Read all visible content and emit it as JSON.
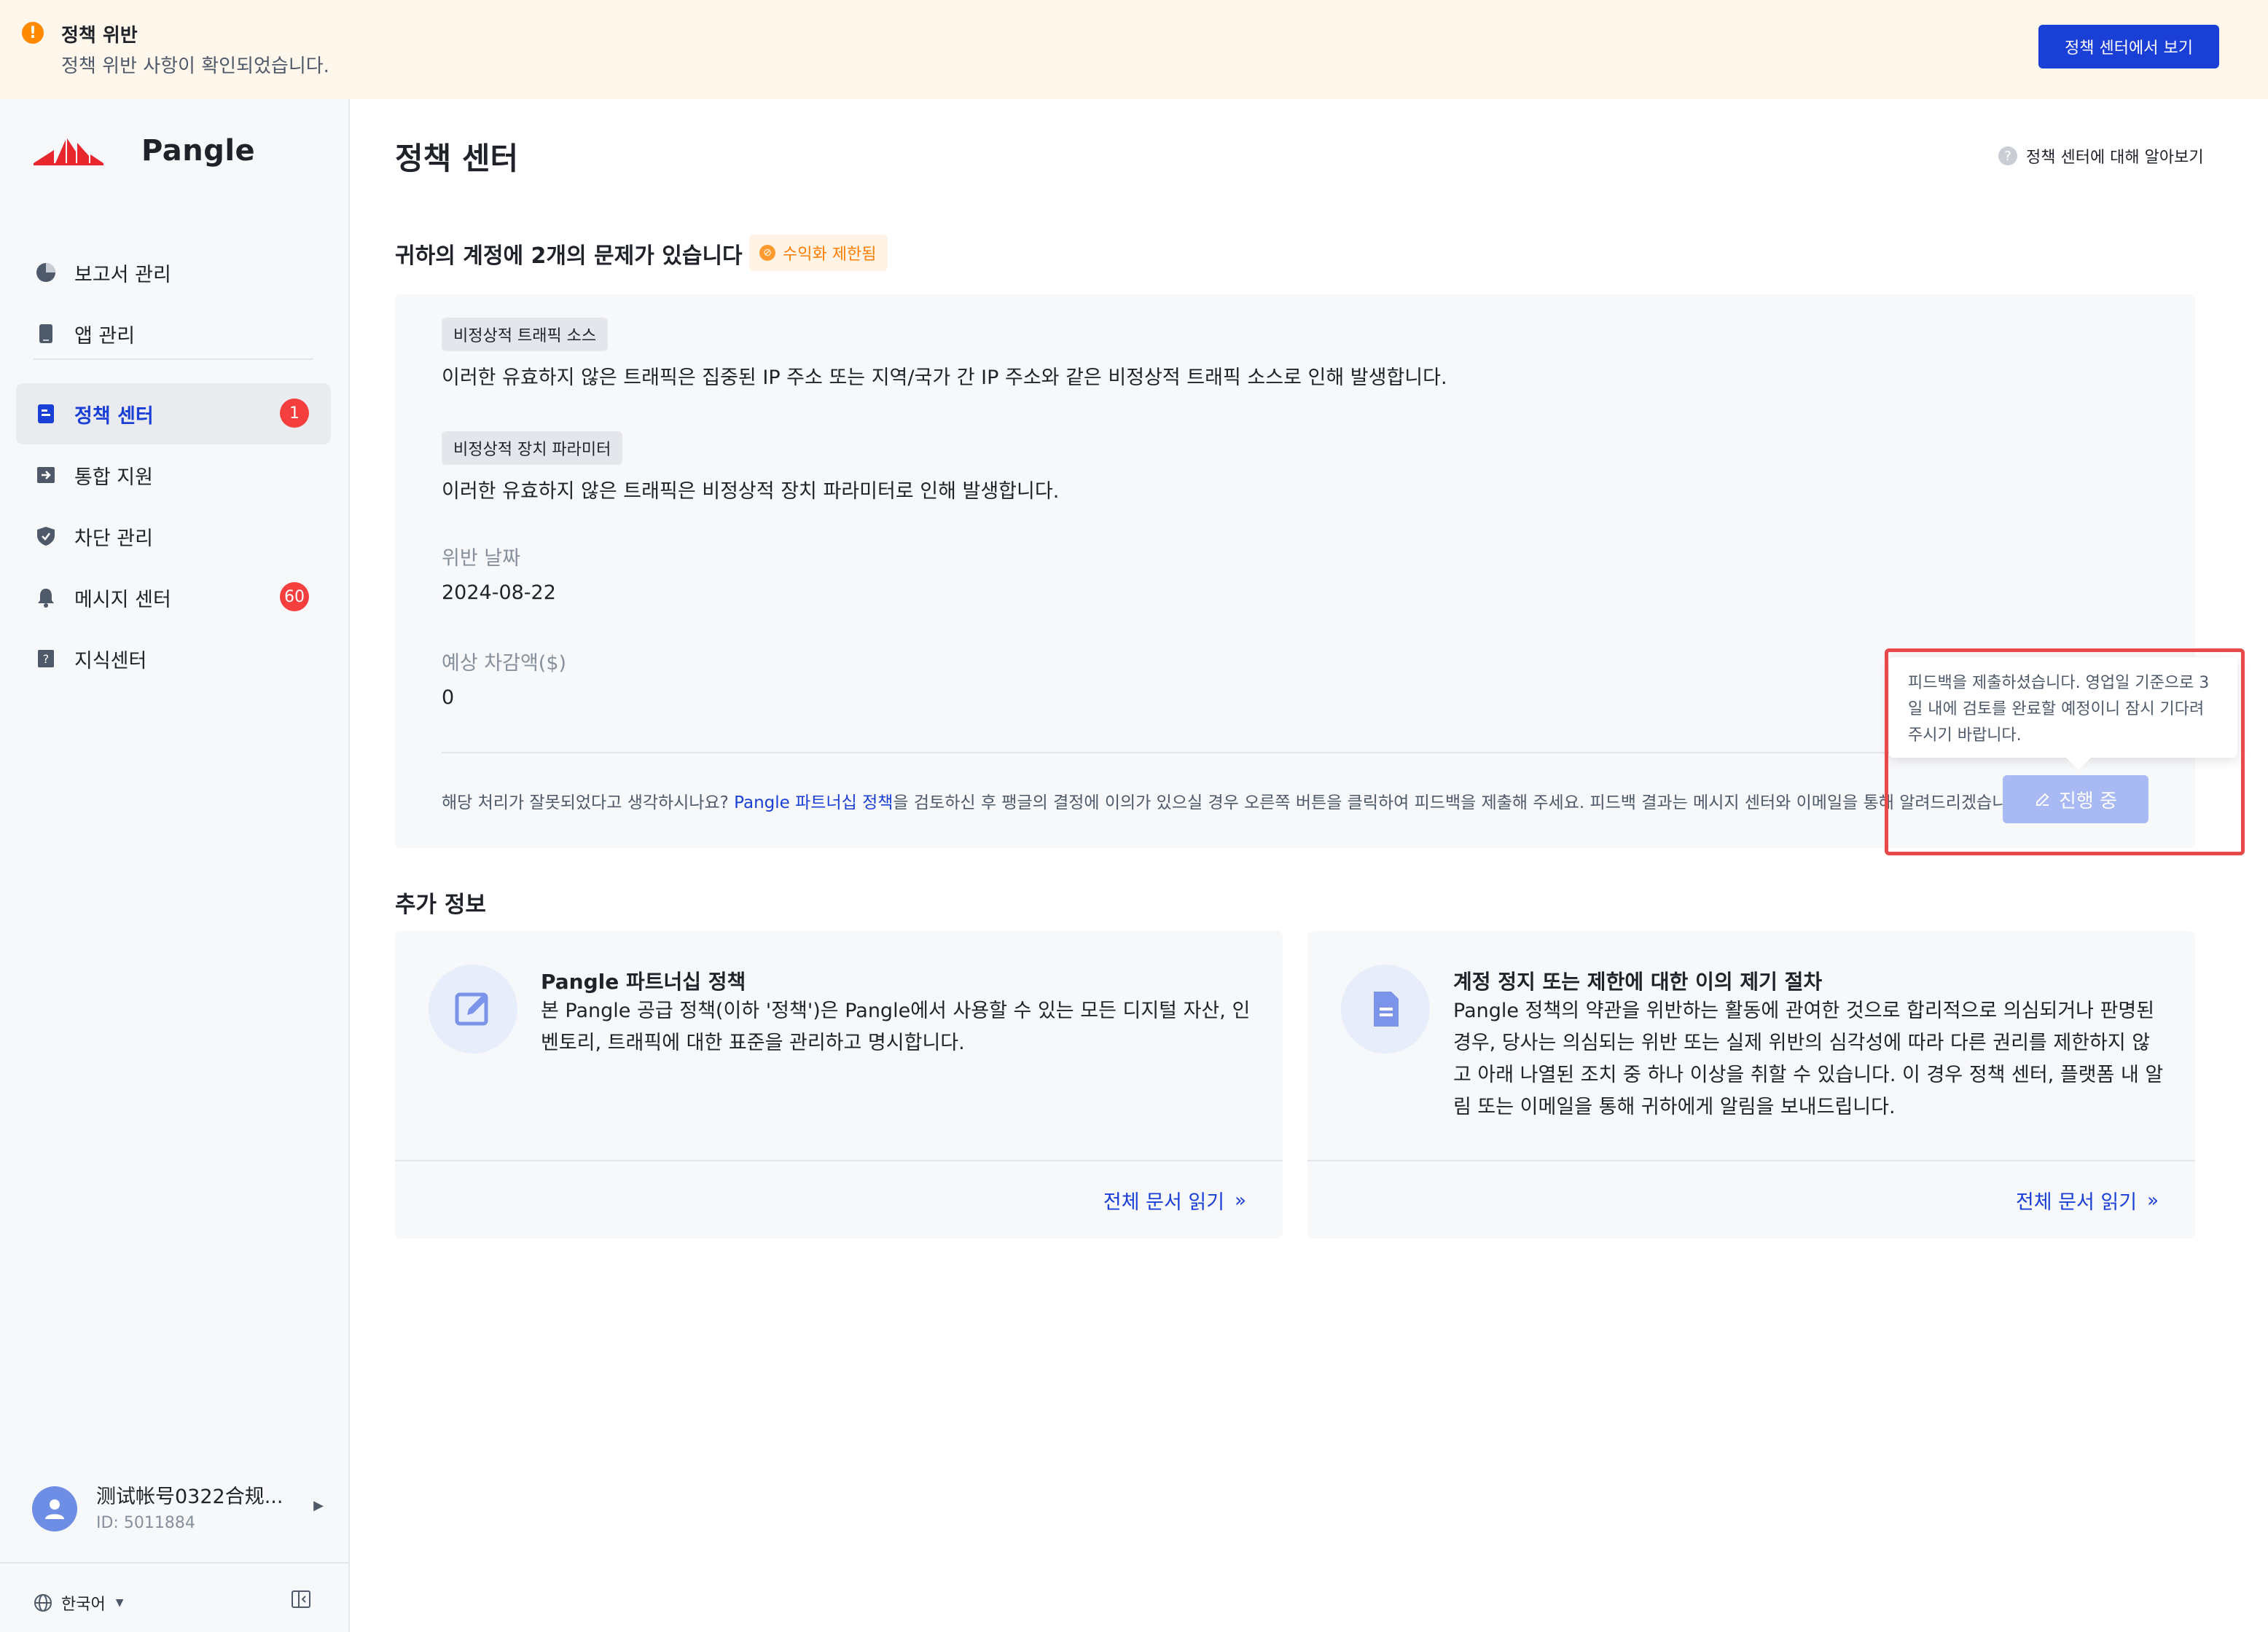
{
  "banner": {
    "title": "정책 위반",
    "description": "정책 위반 사항이 확인되었습니다.",
    "button_label": "정책 센터에서 보기"
  },
  "sidebar": {
    "logo_text": "Pangle",
    "items": [
      {
        "label": "보고서 관리",
        "icon": "pie-chart-icon"
      },
      {
        "label": "앱 관리",
        "icon": "phone-icon"
      },
      {
        "label": "정책 센터",
        "icon": "policy-doc-icon",
        "badge": "1",
        "active": true
      },
      {
        "label": "통합 지원",
        "icon": "integration-icon"
      },
      {
        "label": "차단 관리",
        "icon": "shield-icon"
      },
      {
        "label": "메시지 센터",
        "icon": "bell-icon",
        "badge": "60"
      },
      {
        "label": "지식센터",
        "icon": "knowledge-icon"
      }
    ],
    "user": {
      "name": "测试帐号0322合规...",
      "id": "ID: 5011884"
    },
    "language": "한국어"
  },
  "main": {
    "title": "정책 센터",
    "help_link": "정책 센터에 대해 알아보기",
    "issues_heading": "귀하의 계정에 2개의 문제가 있습니다",
    "status_tag": "수익화 제한됨",
    "issues": [
      {
        "tag": "비정상적 트래픽 소스",
        "description": "이러한 유효하지 않은 트래픽은 집중된 IP 주소 또는 지역/국가 간 IP 주소와 같은 비정상적 트래픽 소스로 인해 발생합니다."
      },
      {
        "tag": "비정상적 장치 파라미터",
        "description": "이러한 유효하지 않은 트래픽은 비정상적 장치 파라미터로 인해 발생합니다."
      }
    ],
    "violation_date_label": "위반 날짜",
    "violation_date": "2024-08-22",
    "deduction_label": "예상 차감액($)",
    "deduction_value": "0",
    "footer_note_before": "해당 처리가 잘못되었다고 생각하시나요? ",
    "footer_note_link": "Pangle 파트너십 정책",
    "footer_note_after": "을 검토하신 후 팽글의 결정에 이의가 있으실 경우 오른쪽 버튼을 클릭하여 피드백을 제출해 주세요. 피드백 결과는 메시지 센터와 이메일을 통해 알려드리겠습니다.",
    "progress_button": "진행 중",
    "tooltip": "피드백을 제출하셨습니다. 영업일 기준으로 3일 내에 검토를 완료할 예정이니 잠시 기다려 주시기 바랍니다."
  },
  "extra": {
    "heading": "추가 정보",
    "cards": [
      {
        "title": "Pangle 파트너십 정책",
        "description": "본 Pangle 공급 정책(이하 '정책')은 Pangle에서 사용할 수 있는 모든 디지털 자산, 인벤토리, 트래픽에 대한 표준을 관리하고 명시합니다.",
        "link": "전체 문서 읽기",
        "icon": "edit-icon"
      },
      {
        "title": "계정 정지 또는 제한에 대한 이의 제기 절차",
        "description": "Pangle 정책의 약관을 위반하는 활동에 관여한 것으로 합리적으로 의심되거나 판명된 경우, 당사는 의심되는 위반 또는 실제 위반의 심각성에 따라 다른 권리를 제한하지 않고 아래 나열된 조치 중 하나 이상을 취할 수 있습니다. 이 경우 정책 센터, 플랫폼 내 알림 또는 이메일을 통해 귀하에게 알림을 보내드립니다.",
        "link": "전체 문서 읽기",
        "icon": "document-icon"
      }
    ]
  },
  "colors": {
    "accent": "#1a3fd6",
    "warning": "#ff8a00",
    "badge": "#f53f3f",
    "highlight": "#e84a4a"
  }
}
